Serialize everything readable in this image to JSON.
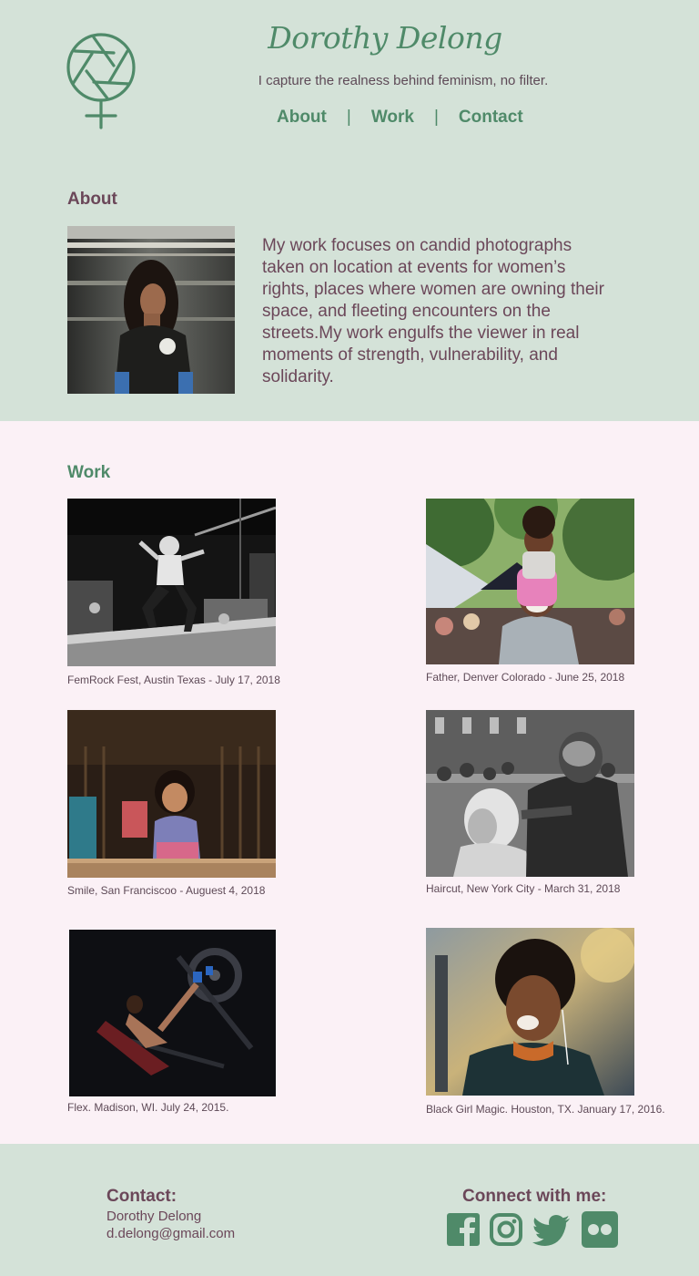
{
  "site": {
    "name": "Dorothy Delong",
    "tagline": "I capture the realness behind feminism, no filter."
  },
  "nav": {
    "items": [
      "About",
      "Work",
      "Contact"
    ],
    "separator": "|"
  },
  "about": {
    "title": "About",
    "text": "My work focuses on candid photographs taken on location at events for women’s rights, places where women are owning their space, and fleeting encounters on the streets.My work engulfs the viewer in real moments of strength, vulnerability, and solidarity."
  },
  "work": {
    "title": "Work",
    "items": [
      {
        "caption": "FemRock Fest, Austin Texas - July 17, 2018"
      },
      {
        "caption": "Father, Denver Colorado - June 25, 2018"
      },
      {
        "caption": "Smile, San Franciscoo - Auguest 4, 2018"
      },
      {
        "caption": "Haircut, New York City - March 31, 2018"
      },
      {
        "caption": "Flex. Madison, WI. July 24, 2015."
      },
      {
        "caption": "Black Girl Magic. Houston, TX. January 17, 2016."
      }
    ]
  },
  "footer": {
    "contact_title": "Contact:",
    "contact_name": "Dorothy Delong",
    "contact_email": "d.delong@gmail.com",
    "connect_title": "Connect with me:",
    "social_icons": [
      "facebook-icon",
      "instagram-icon",
      "twitter-icon",
      "flickr-icon"
    ]
  },
  "colors": {
    "background_green": "#d4e2d8",
    "work_background_pink": "#fbf1f6",
    "accent_green": "#4f8a69",
    "text_plum": "#6b4759"
  }
}
